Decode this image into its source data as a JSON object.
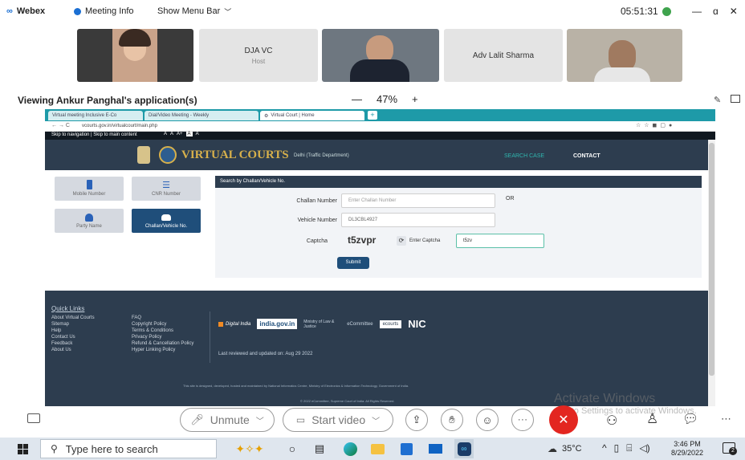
{
  "webex": {
    "app_name": "Webex",
    "meeting_info": "Meeting Info",
    "show_menu_bar": "Show Menu Bar",
    "clock": "05:51:31",
    "win_min": "—",
    "win_max": "ɑ",
    "win_close": "✕"
  },
  "participants": [
    {
      "name": "DJA VC",
      "role": "Host"
    },
    {
      "name": "Adv Lalit Sharma"
    }
  ],
  "share_bar": {
    "title": "Viewing Ankur Panghal's application(s)",
    "zoom_out": "—",
    "zoom": "47%",
    "zoom_in": "+"
  },
  "browser": {
    "tabs": [
      "Virtual meeting Inclusive E-Co",
      "Dial/Video Meeting - Weekly",
      "Virtual Court | Home"
    ],
    "new_tab": "+",
    "url": "vcourts.gov.in/virtualcourt/main.php",
    "skip_bar": "Skip to navigation | Skip to main content",
    "font_sizes": [
      "A",
      "A",
      "A+",
      "A",
      "A"
    ]
  },
  "vc": {
    "brand": "VIRTUAL COURTS",
    "subtitle": "Delhi (Traffic Department)",
    "nav_search": "SEARCH CASE",
    "nav_contact": "CONTACT",
    "tiles": [
      "Mobile Number",
      "CNR Number",
      "Party Name",
      "Challan/Vehicle No."
    ],
    "form_title": "Search by Challan/Vehicle No.",
    "challan_label": "Challan Number",
    "challan_placeholder": "Enter Challan Number",
    "or_text": "OR",
    "vehicle_label": "Vehicle Number",
    "vehicle_value": "DL3CBL4927",
    "captcha_label": "Captcha",
    "captcha_value": "t5zvpr",
    "refresh_icon": "⟳",
    "enter_captcha_label": "Enter Captcha",
    "captcha_input": "t5zv",
    "submit": "Submit",
    "quick_links_title": "Quick Links",
    "links_col1": [
      "About Virtual Courts",
      "Sitemap",
      "Help",
      "Contact Us",
      "Feedback",
      "About Us"
    ],
    "links_col2": [
      "FAQ",
      "Copyright Policy",
      "Terms & Conditions",
      "Privacy Policy",
      "Refund & Cancellation Policy",
      "Hyper Linking Policy"
    ],
    "logos": [
      "Digital India",
      "india.gov.in",
      "Ministry of Law & Justice",
      "eCommittee",
      "ecourts",
      "NIC"
    ],
    "last_reviewed": "Last reviewed and updated on: Aug 29 2022",
    "footer_line": "This site is designed, developed, hosted and maintained by National Informatics Centre, Ministry of Electronics & Information Technology, Government of India.",
    "footer_line2": "© 2022 eCommittee, Supreme Court of India. All Rights Reserved."
  },
  "watermark": {
    "line1": "Activate Windows",
    "line2": "Go to Settings to activate Windows."
  },
  "controls": {
    "unmute": "Unmute",
    "start_video": "Start video"
  },
  "taskbar": {
    "search_placeholder": "Type here to search",
    "weather": "35°C",
    "time": "3:46 PM",
    "date": "8/29/2022",
    "notification_count": "2"
  },
  "colors": {
    "vc_dark": "#2d3d4f",
    "vc_blue": "#1f4e7a",
    "webex_end_red": "#e32620",
    "browser_teal": "#1e9aa8"
  }
}
